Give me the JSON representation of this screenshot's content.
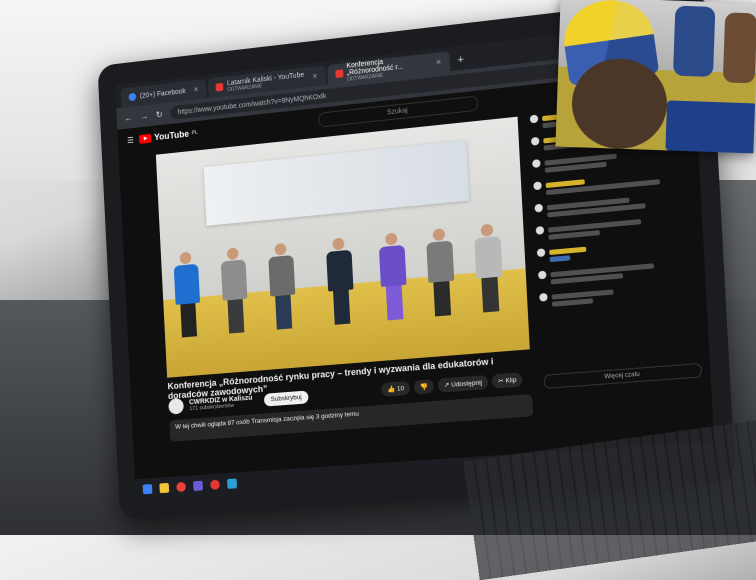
{
  "browser": {
    "tabs": [
      {
        "label": "(20+) Facebook",
        "sub": ""
      },
      {
        "label": "Latarnik Kaliski - YouTube",
        "sub": "ODTWARZANIE"
      },
      {
        "label": "Konferencja „Różnorodność r...",
        "sub": "ODTWARZANIE"
      }
    ],
    "new_tab": "+",
    "url": "https://www.youtube.com/watch?v=9NyMQhKOxlk"
  },
  "youtube": {
    "logo_text": "YouTube",
    "logo_country": "PL",
    "search_placeholder": "Szukaj",
    "video_title": "Konferencja „Różnorodność rynku pracy – trendy i wyzwania dla edukatorów i doradców zawodowych”",
    "channel_name": "CWRKDIZ w Kaliszu",
    "subscribers": "171 subskrybentów",
    "subscribe_label": "Subskrybuj",
    "likes": "10",
    "share_label": "Udostępnij",
    "clip_label": "Klip",
    "description": "W tej chwili ogląda 87 osób  Transmisja zaczęła się 3 godziny temu",
    "chat_footer": "Więcej czatu"
  },
  "colors": {
    "youtube_red": "#ff0000",
    "chat_highlight": "#d6b42a",
    "stage_floor": "#e0c04a"
  }
}
